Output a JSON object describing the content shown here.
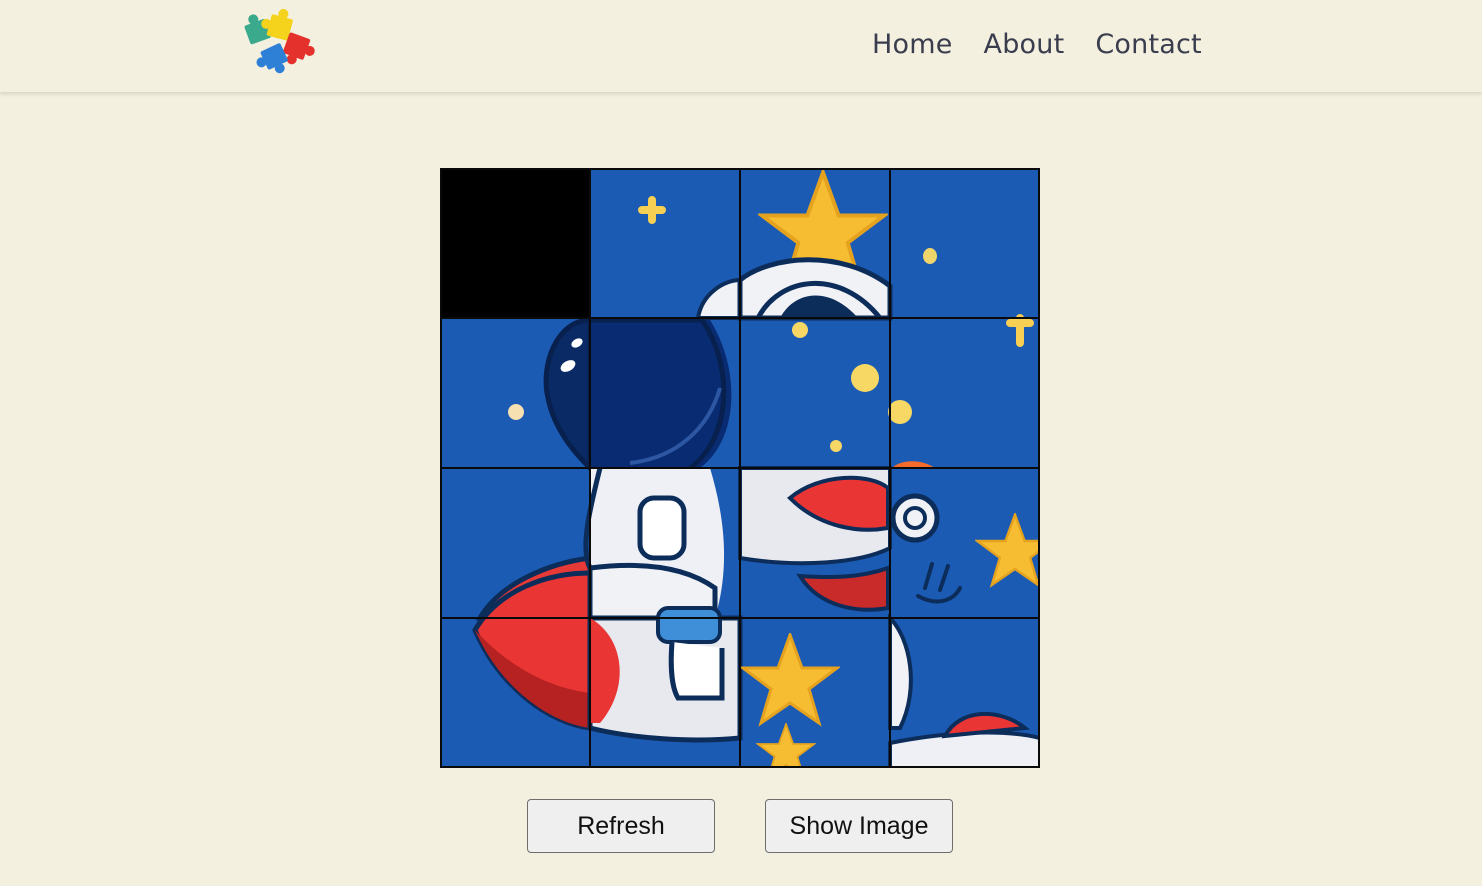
{
  "header": {
    "logo": {
      "icon": "puzzle-pieces-logo",
      "colors": [
        "#3aa98c",
        "#f5d21b",
        "#e5312b",
        "#2e7fd6"
      ]
    },
    "nav": [
      {
        "label": "Home"
      },
      {
        "label": "About"
      },
      {
        "label": "Contact"
      }
    ]
  },
  "puzzle": {
    "grid": "4x4",
    "empty_tile": "top-left",
    "image_subject": "astronaut-on-rocket",
    "colors": {
      "space": "#1b5bb4",
      "empty": "#000000",
      "grid_line": "#0a0a0a"
    }
  },
  "controls": {
    "refresh_label": "Refresh",
    "show_image_label": "Show Image"
  }
}
